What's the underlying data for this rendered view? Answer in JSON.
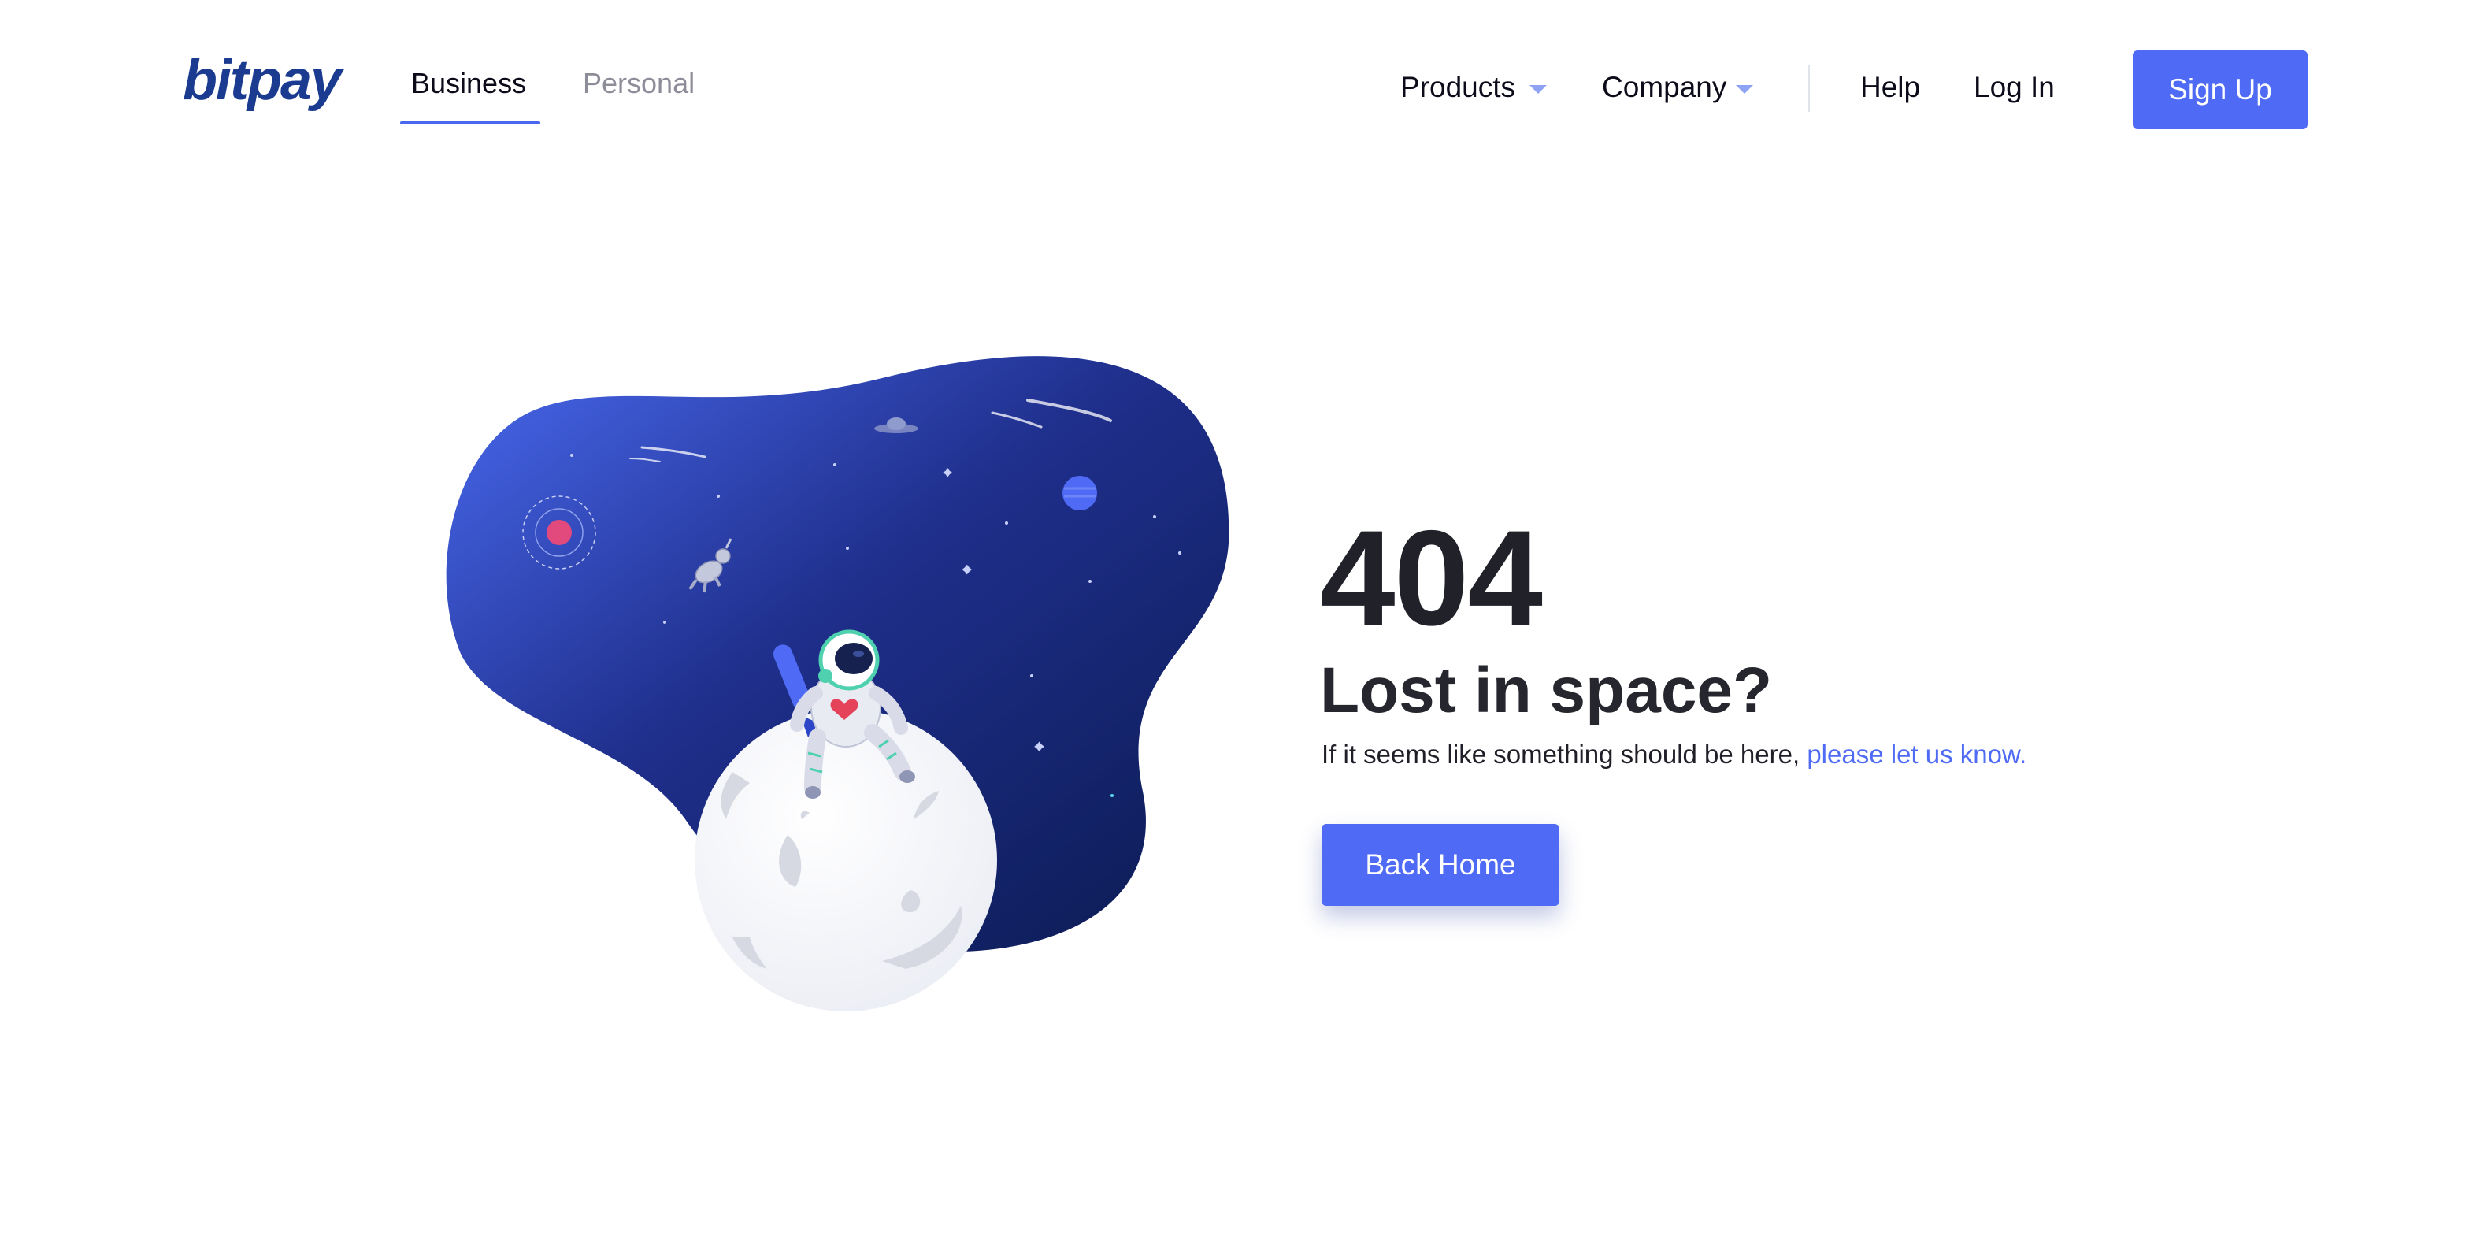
{
  "header": {
    "logo_text": "bitpay",
    "tabs": [
      {
        "label": "Business",
        "active": true
      },
      {
        "label": "Personal",
        "active": false
      }
    ],
    "nav": {
      "products": "Products",
      "company": "Company",
      "help": "Help",
      "login": "Log In",
      "signup": "Sign Up"
    }
  },
  "error": {
    "code": "404",
    "headline": "Lost in space?",
    "message_prefix": "If it seems like something should be here, ",
    "message_link": "please let us know."
  },
  "actions": {
    "back_home": "Back Home"
  },
  "illustration": {
    "icons": [
      "space-blob",
      "moon",
      "astronaut",
      "unicorn",
      "planet",
      "ufo",
      "shooting-stars",
      "orbit-planet",
      "stars"
    ]
  },
  "colors": {
    "accent": "#4f6bf5",
    "brand": "#1a3b8f",
    "space_light": "#4361e6",
    "space_dark": "#0b1a50",
    "heart": "#e4435a",
    "suit_trim": "#4fd1b0"
  }
}
